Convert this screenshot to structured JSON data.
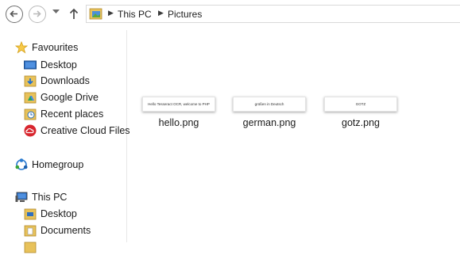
{
  "nav": {
    "back_icon": "back-arrow-icon",
    "forward_icon": "forward-arrow-icon",
    "up_icon": "up-arrow-icon"
  },
  "address": {
    "breadcrumbs": [
      "This PC",
      "Pictures"
    ]
  },
  "sidebar": {
    "favourites": {
      "label": "Favourites",
      "items": [
        {
          "label": "Desktop"
        },
        {
          "label": "Downloads"
        },
        {
          "label": "Google Drive"
        },
        {
          "label": "Recent places"
        },
        {
          "label": "Creative Cloud Files"
        }
      ]
    },
    "homegroup": {
      "label": "Homegroup"
    },
    "this_pc": {
      "label": "This PC",
      "items": [
        {
          "label": "Desktop"
        },
        {
          "label": "Documents"
        }
      ]
    }
  },
  "files": [
    {
      "name": "hello.png",
      "thumb_text": "Hello Tesseract OCR, welcome to PHP"
    },
    {
      "name": "german.png",
      "thumb_text": "grüßen in Deutsch"
    },
    {
      "name": "gotz.png",
      "thumb_text": "GOTZ"
    }
  ]
}
